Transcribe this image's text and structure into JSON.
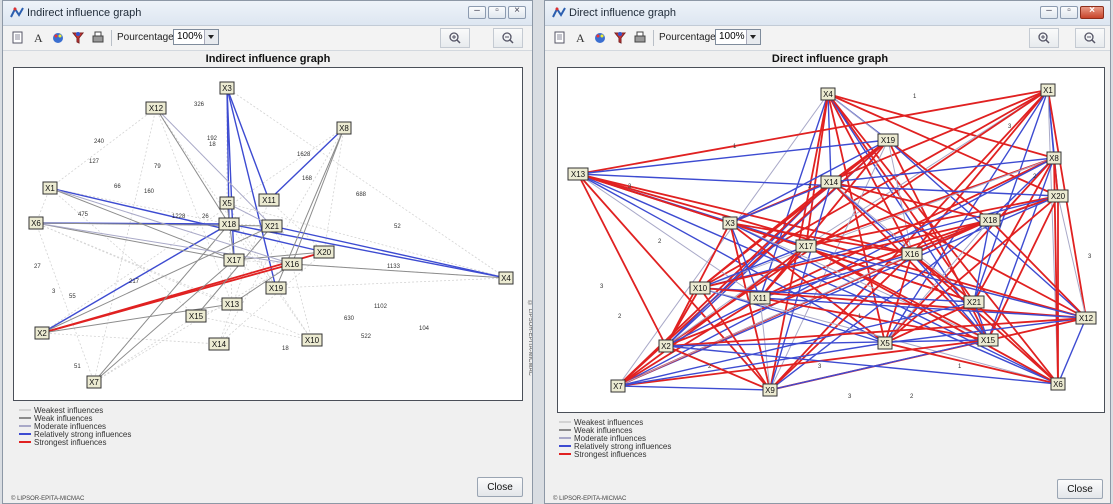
{
  "windows": {
    "left": {
      "title": "Indirect influence graph",
      "graph_title": "Indirect influence graph",
      "side_watermark": "© LIPSOR-EPITA-MICMAC",
      "copyright": "© LIPSOR-EPITA-MICMAC",
      "close_label": "Close",
      "nodes": [
        {
          "id": "X3",
          "label": "X3"
        },
        {
          "id": "X12",
          "label": "X12"
        },
        {
          "id": "X8",
          "label": "X8"
        },
        {
          "id": "X1",
          "label": "X1"
        },
        {
          "id": "X5",
          "label": "X5"
        },
        {
          "id": "X6",
          "label": "X6"
        },
        {
          "id": "X2",
          "label": "X2"
        },
        {
          "id": "X7",
          "label": "X7"
        },
        {
          "id": "X4",
          "label": "X4"
        },
        {
          "id": "X18",
          "label": "X18"
        },
        {
          "id": "X11",
          "label": "X11"
        },
        {
          "id": "X21",
          "label": "X21"
        },
        {
          "id": "X17",
          "label": "X17"
        },
        {
          "id": "X16",
          "label": "X16"
        },
        {
          "id": "X20",
          "label": "X20"
        },
        {
          "id": "X13",
          "label": "X13"
        },
        {
          "id": "X19",
          "label": "X19"
        },
        {
          "id": "X15",
          "label": "X15"
        },
        {
          "id": "X14",
          "label": "X14"
        },
        {
          "id": "X10",
          "label": "X10"
        }
      ],
      "edge_labels": [
        "240",
        "127",
        "326",
        "18",
        "66",
        "192",
        "79",
        "1628",
        "168",
        "475",
        "160",
        "26",
        "688",
        "52",
        "27",
        "55",
        "217",
        "1102",
        "630",
        "522",
        "104",
        "51",
        "18",
        "1133",
        "1228",
        "3"
      ]
    },
    "right": {
      "title": "Direct influence graph",
      "graph_title": "Direct influence graph",
      "copyright": "© LIPSOR-EPITA-MICMAC",
      "close_label": "Close",
      "nodes": [
        {
          "id": "X4",
          "label": "X4"
        },
        {
          "id": "X1",
          "label": "X1"
        },
        {
          "id": "X19",
          "label": "X19"
        },
        {
          "id": "X8",
          "label": "X8"
        },
        {
          "id": "X13",
          "label": "X13"
        },
        {
          "id": "X14",
          "label": "X14"
        },
        {
          "id": "X20",
          "label": "X20"
        },
        {
          "id": "X3",
          "label": "X3"
        },
        {
          "id": "X18",
          "label": "X18"
        },
        {
          "id": "X17",
          "label": "X17"
        },
        {
          "id": "X16",
          "label": "X16"
        },
        {
          "id": "X10",
          "label": "X10"
        },
        {
          "id": "X11",
          "label": "X11"
        },
        {
          "id": "X21",
          "label": "X21"
        },
        {
          "id": "X12",
          "label": "X12"
        },
        {
          "id": "X15",
          "label": "X15"
        },
        {
          "id": "X5",
          "label": "X5"
        },
        {
          "id": "X2",
          "label": "X2"
        },
        {
          "id": "X7",
          "label": "X7"
        },
        {
          "id": "X6",
          "label": "X6"
        },
        {
          "id": "X9",
          "label": "X9"
        }
      ],
      "edge_labels": [
        "3",
        "1",
        "2",
        "3",
        "2",
        "1",
        "3",
        "2",
        "3",
        "1",
        "2",
        "3",
        "2",
        "1",
        "3",
        "3"
      ]
    }
  },
  "toolbar": {
    "percent_label": "Pourcentage :",
    "percent_value": "100%"
  },
  "legend": [
    {
      "label": "Weakest influences",
      "color": "#d3d3d3"
    },
    {
      "label": "Weak influences",
      "color": "#8c8c8c"
    },
    {
      "label": "Moderate influences",
      "color": "#a9a9c8"
    },
    {
      "label": "Relatively strong influences",
      "color": "#3d4bd1"
    },
    {
      "label": "Strongest influences",
      "color": "#e02121"
    }
  ],
  "colors": {
    "weakest": "#d3d3d3",
    "weak": "#8c8c8c",
    "moderate": "#a9a9c8",
    "relstrong": "#3d4bd1",
    "strongest": "#e02121"
  }
}
